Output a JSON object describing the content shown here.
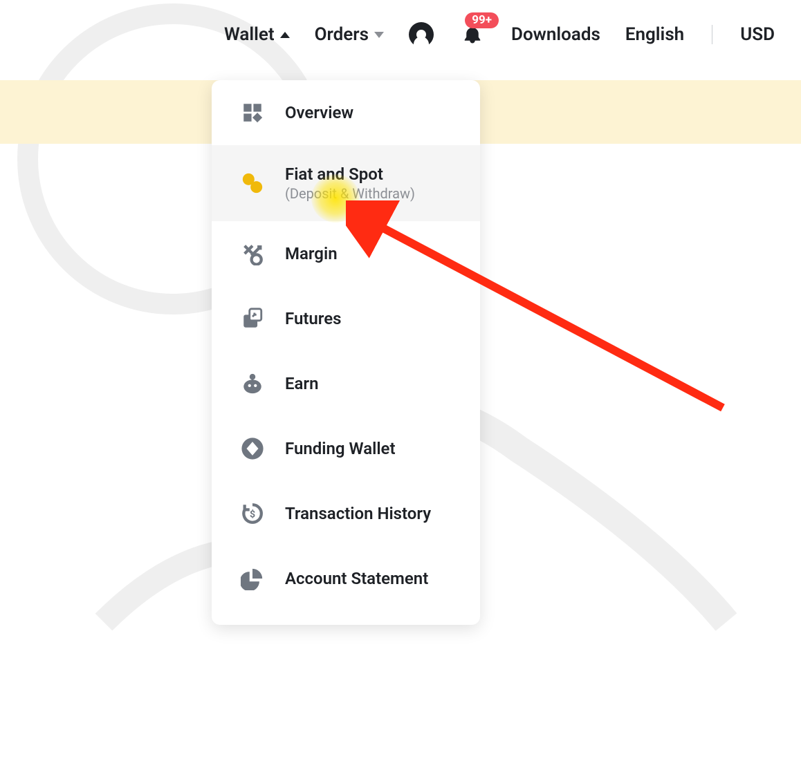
{
  "topnav": {
    "wallet_label": "Wallet",
    "orders_label": "Orders",
    "downloads_label": "Downloads",
    "language_label": "English",
    "currency_label": "USD",
    "notification_badge": "99+"
  },
  "wallet_dropdown": {
    "items": [
      {
        "icon": "overview-icon",
        "label": "Overview"
      },
      {
        "icon": "fiat-spot-icon",
        "label": "Fiat and Spot",
        "sub": "(Deposit & Withdraw)",
        "active": true
      },
      {
        "icon": "margin-icon",
        "label": "Margin"
      },
      {
        "icon": "futures-icon",
        "label": "Futures"
      },
      {
        "icon": "earn-icon",
        "label": "Earn"
      },
      {
        "icon": "funding-wallet-icon",
        "label": "Funding Wallet"
      },
      {
        "icon": "transaction-history-icon",
        "label": "Transaction History"
      },
      {
        "icon": "account-statement-icon",
        "label": "Account Statement"
      }
    ]
  }
}
